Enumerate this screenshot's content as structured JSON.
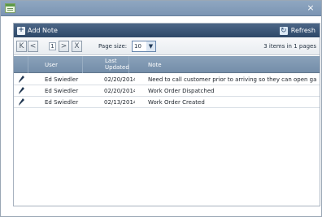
{
  "window": {
    "title_icon": "note-window-icon",
    "close_label": "×"
  },
  "toolbar": {
    "add_note_label": "Add Note",
    "refresh_label": "Refresh",
    "add_icon": "plus-icon",
    "refresh_icon": "refresh-icon"
  },
  "pager": {
    "first_label": "K",
    "prev_label": "<",
    "current_page": "1",
    "next_label": ">",
    "last_label": "X",
    "page_size_label": "Page size:",
    "page_size_value": "10",
    "page_size_arrow": "▼",
    "summary": "3 items in 1 pages"
  },
  "grid": {
    "headers": {
      "user": "User",
      "last_updated": "Last Updated",
      "note": "Note"
    },
    "rows": [
      {
        "edit_icon": "pencil-icon",
        "user": "Ed Swiedler",
        "updated": "02/20/2014",
        "note": "Need to call customer prior to arriving so they can open ga"
      },
      {
        "edit_icon": "pencil-icon",
        "user": "Ed Swiedler",
        "updated": "02/20/2014",
        "note": "Work Order Dispatched"
      },
      {
        "edit_icon": "pencil-icon",
        "user": "Ed Swiedler",
        "updated": "02/13/2014",
        "note": "Work Order Created"
      }
    ]
  },
  "colors": {
    "titlebar": "#8fa7c1",
    "toolbar": "#3f5a7a",
    "header": "#7f99b3",
    "pencil": "#1f3550"
  }
}
